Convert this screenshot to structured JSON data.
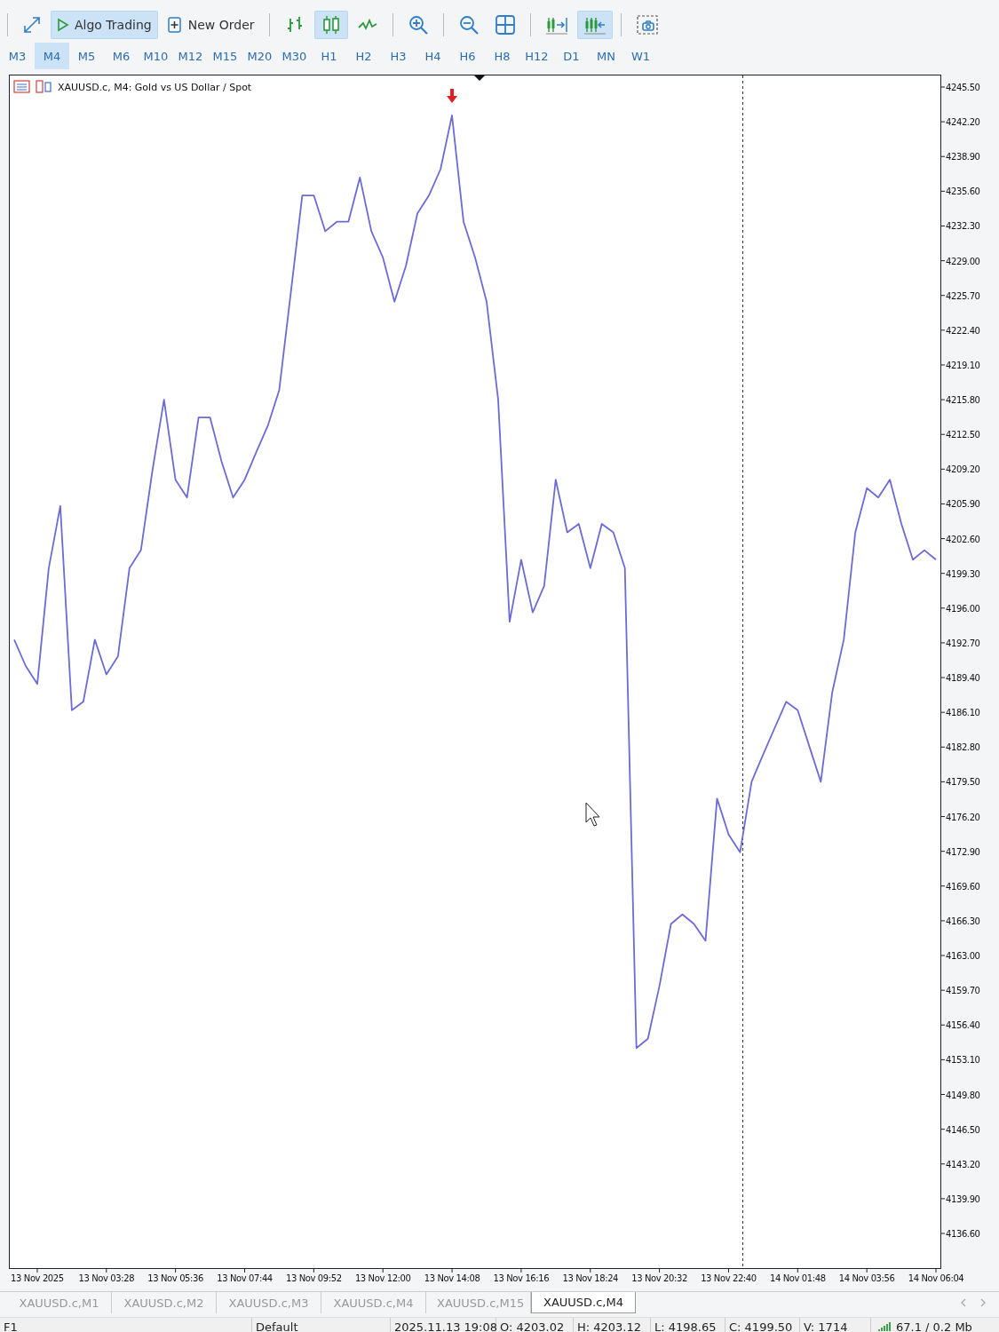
{
  "toolbar": {
    "groups": [
      [
        {
          "kind": "expand",
          "selected": false
        },
        {
          "kind": "algo",
          "label": "Algo Trading",
          "selected": true
        },
        {
          "kind": "order",
          "label": "New Order",
          "selected": false
        }
      ],
      [
        {
          "kind": "bars",
          "selected": false
        },
        {
          "kind": "candles",
          "selected": true
        },
        {
          "kind": "line",
          "selected": false
        }
      ],
      [
        {
          "kind": "zoom-in",
          "selected": false
        }
      ],
      [
        {
          "kind": "zoom-out",
          "selected": false
        },
        {
          "kind": "tile",
          "selected": false
        }
      ],
      [
        {
          "kind": "autoscroll",
          "selected": false
        },
        {
          "kind": "shift",
          "selected": true
        }
      ],
      [
        {
          "kind": "screenshot",
          "selected": false
        }
      ]
    ]
  },
  "timeframes": [
    {
      "label": "M3",
      "selected": false
    },
    {
      "label": "M4",
      "selected": true
    },
    {
      "label": "M5",
      "selected": false
    },
    {
      "label": "M6",
      "selected": false
    },
    {
      "label": "M10",
      "selected": false
    },
    {
      "label": "M12",
      "selected": false
    },
    {
      "label": "M15",
      "selected": false
    },
    {
      "label": "M20",
      "selected": false
    },
    {
      "label": "M30",
      "selected": false
    },
    {
      "label": "H1",
      "selected": false
    },
    {
      "label": "H2",
      "selected": false
    },
    {
      "label": "H3",
      "selected": false
    },
    {
      "label": "H4",
      "selected": false
    },
    {
      "label": "H6",
      "selected": false
    },
    {
      "label": "H8",
      "selected": false
    },
    {
      "label": "H12",
      "selected": false
    },
    {
      "label": "D1",
      "selected": false
    },
    {
      "label": "MN",
      "selected": false
    },
    {
      "label": "W1",
      "selected": false
    }
  ],
  "chart": {
    "chart_data": {
      "type": "line",
      "title": "XAUUSD.c, M4:  Gold vs US Dollar / Spot",
      "categories": [
        null,
        null,
        "13 Nov 2025",
        null,
        null,
        null,
        null,
        null,
        "13 Nov 03:28",
        null,
        null,
        null,
        null,
        null,
        "13 Nov 05:36",
        null,
        null,
        null,
        null,
        null,
        "13 Nov 07:44",
        null,
        null,
        null,
        null,
        null,
        "13 Nov 09:52",
        null,
        null,
        null,
        null,
        null,
        "13 Nov 12:00",
        null,
        null,
        null,
        null,
        null,
        "13 Nov 14:08",
        null,
        null,
        null,
        null,
        null,
        "13 Nov 16:16",
        null,
        null,
        null,
        null,
        null,
        "13 Nov 18:24",
        null,
        null,
        null,
        null,
        null,
        "13 Nov 20:32",
        null,
        null,
        null,
        null,
        null,
        "13 Nov 22:40",
        null,
        null,
        null,
        null,
        null,
        "14 Nov 01:48",
        null,
        null,
        null,
        null,
        null,
        "14 Nov 03:56",
        null,
        null,
        null,
        null,
        null,
        "14 Nov 06:04"
      ],
      "series": [
        {
          "color": "#6b6bd6",
          "values": [
            4193.0,
            4190.5,
            4188.8,
            4199.8,
            4205.7,
            4186.3,
            4187.1,
            4193.0,
            4189.7,
            4191.4,
            4199.8,
            4201.5,
            4209.1,
            4215.8,
            4208.2,
            4206.5,
            4214.1,
            4214.1,
            4209.9,
            4206.5,
            4208.2,
            4210.8,
            4213.3,
            4216.7,
            4225.9,
            4235.2,
            4235.2,
            4231.8,
            4232.7,
            4232.7,
            4236.9,
            4231.8,
            4229.3,
            4225.1,
            4228.5,
            4233.5,
            4235.2,
            4237.7,
            4242.8,
            4232.7,
            4229.3,
            4225.1,
            4215.8,
            4194.7,
            4200.6,
            4195.6,
            4198.1,
            4208.2,
            4203.2,
            4204.0,
            4199.8,
            4204.0,
            4203.2,
            4199.8,
            4154.2,
            4155.1,
            4160.1,
            4166.0,
            4166.9,
            4166.0,
            4164.4,
            4177.9,
            4174.5,
            4172.8,
            4179.5,
            4182.1,
            4184.6,
            4187.1,
            4186.3,
            4182.9,
            4179.5,
            4188.0,
            4193.0,
            4203.2,
            4207.4,
            4206.5,
            4208.2,
            4204.0,
            4200.6,
            4201.5,
            4200.6
          ]
        }
      ],
      "ylim": [
        4133.31,
        4246.68
      ],
      "yticks": [
        {
          "value": 4245.5,
          "label": "4245.50"
        },
        {
          "value": 4242.2,
          "label": "4242.20"
        },
        {
          "value": 4238.9,
          "label": "4238.90"
        },
        {
          "value": 4235.6,
          "label": "4235.60"
        },
        {
          "value": 4232.3,
          "label": "4232.30"
        },
        {
          "value": 4229.0,
          "label": "4229.00"
        },
        {
          "value": 4225.7,
          "label": "4225.70"
        },
        {
          "value": 4222.4,
          "label": "4222.40"
        },
        {
          "value": 4219.1,
          "label": "4219.10"
        },
        {
          "value": 4215.8,
          "label": "4215.80"
        },
        {
          "value": 4212.5,
          "label": "4212.50"
        },
        {
          "value": 4209.2,
          "label": "4209.20"
        },
        {
          "value": 4205.9,
          "label": "4205.90"
        },
        {
          "value": 4202.6,
          "label": "4202.60"
        },
        {
          "value": 4199.3,
          "label": "4199.30"
        },
        {
          "value": 4196.0,
          "label": "4196.00"
        },
        {
          "value": 4192.7,
          "label": "4192.70"
        },
        {
          "value": 4189.4,
          "label": "4189.40"
        },
        {
          "value": 4186.1,
          "label": "4186.10"
        },
        {
          "value": 4182.8,
          "label": "4182.80"
        },
        {
          "value": 4179.5,
          "label": "4179.50"
        },
        {
          "value": 4176.2,
          "label": "4176.20"
        },
        {
          "value": 4172.9,
          "label": "4172.90"
        },
        {
          "value": 4169.6,
          "label": "4169.60"
        },
        {
          "value": 4166.3,
          "label": "4166.30"
        },
        {
          "value": 4163.0,
          "label": "4163.00"
        },
        {
          "value": 4159.7,
          "label": "4159.70"
        },
        {
          "value": 4156.4,
          "label": "4156.40"
        },
        {
          "value": 4153.1,
          "label": "4153.10"
        },
        {
          "value": 4149.8,
          "label": "4149.80"
        },
        {
          "value": 4146.5,
          "label": "4146.50"
        },
        {
          "value": 4143.2,
          "label": "4143.20"
        },
        {
          "value": 4139.9,
          "label": "4139.90"
        },
        {
          "value": 4136.6,
          "label": "4136.60"
        }
      ]
    }
  },
  "tabs": [
    {
      "label": "XAUUSD.c,M1",
      "selected": false
    },
    {
      "label": "XAUUSD.c,M2",
      "selected": false
    },
    {
      "label": "XAUUSD.c,M3",
      "selected": false
    },
    {
      "label": "XAUUSD.c,M4",
      "selected": false
    },
    {
      "label": "XAUUSD.c,M15",
      "selected": false
    },
    {
      "label": "XAUUSD.c,M4",
      "selected": true
    }
  ],
  "status_bar": {
    "help": "F1",
    "profile": "Default",
    "datetime": "2025.11.13 19:08",
    "open": "O: 4203.02",
    "high": "H: 4203.12",
    "low": "L: 4198.65",
    "close": "C: 4199.50",
    "volume": "V: 1714",
    "traffic": "67.1 / 0.2 Mb"
  }
}
